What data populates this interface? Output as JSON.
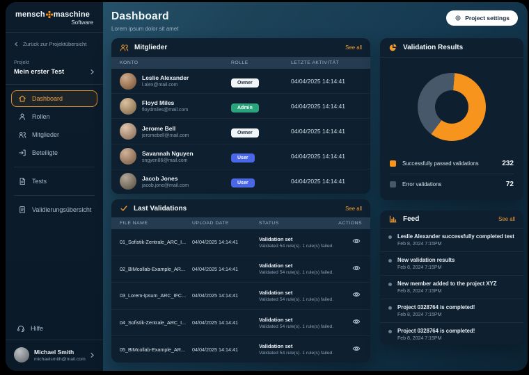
{
  "header": {
    "title": "Dashboard",
    "subtitle": "Lorem ipsum dolor sit amet",
    "settings_button": "Project settings"
  },
  "sidebar": {
    "logo": {
      "word1": "mensch",
      "word2": "maschine",
      "subtitle": "Software"
    },
    "back_link": "Zurück zur Projektübersicht",
    "project": {
      "label": "Projekt",
      "name": "Mein erster Test"
    },
    "nav": [
      {
        "label": "Dashboard"
      },
      {
        "label": "Rollen"
      },
      {
        "label": "Mitglieder"
      },
      {
        "label": "Beteiligte"
      },
      {
        "label": "Tests"
      },
      {
        "label": "Validierungsübersicht"
      }
    ],
    "help_label": "Hilfe",
    "user": {
      "name": "Michael Smith",
      "email": "michaelsmith@mail.com",
      "avatar_color": "#97a0a6"
    }
  },
  "members": {
    "title": "Mitglieder",
    "see_all": "See all",
    "columns": {
      "account": "KONTO",
      "role": "ROLLE",
      "activity": "LETZTE AKTIVITÄT"
    },
    "rows": [
      {
        "name": "Leslie Alexander",
        "email": "l.alex@mail.com",
        "role": "Owner",
        "role_bg": "#f2f5f8",
        "role_fg": "#1d2f41",
        "activity": "04/04/2025 14:14:41",
        "avatar_color": "#b97f4e"
      },
      {
        "name": "Floyd Miles",
        "email": "floydmiles@mail.com",
        "role": "Admin",
        "role_bg": "#2aa57b",
        "role_fg": "#ffffff",
        "activity": "04/04/2025 14:14:41",
        "avatar_color": "#c9a06b"
      },
      {
        "name": "Jerome Bell",
        "email": "jeromebell@mail.com",
        "role": "Owner",
        "role_bg": "#f2f5f8",
        "role_fg": "#1d2f41",
        "activity": "04/04/2025 14:14:41",
        "avatar_color": "#d3a882"
      },
      {
        "name": "Savannah Nguyen",
        "email": "sngyen86@mail.com",
        "role": "User",
        "role_bg": "#4a67e8",
        "role_fg": "#ffffff",
        "activity": "04/04/2025 14:14:41",
        "avatar_color": "#b98a63"
      },
      {
        "name": "Jacob Jones",
        "email": "jacob.jone@mail.com",
        "role": "User",
        "role_bg": "#4a67e8",
        "role_fg": "#ffffff",
        "activity": "04/04/2025 14:14:41",
        "avatar_color": "#8a7a62"
      }
    ]
  },
  "validations": {
    "title": "Last Validations",
    "see_all": "See all",
    "columns": {
      "file": "FILE NAME",
      "date": "UPLOAD DATE",
      "status": "STATUS",
      "actions": "ACTIONS"
    },
    "rows": [
      {
        "file": "01_Sofistik-Zentrale_ARC_I...",
        "date": "04/04/2025 14:14:41",
        "status_title": "Validation set",
        "status_sub": "Validated 54 rule(s). 1 rule(s) failed."
      },
      {
        "file": "02_BIMcollab-Example_AR...",
        "date": "04/04/2025 14:14:41",
        "status_title": "Validation set",
        "status_sub": "Validated 54 rule(s). 1 rule(s) failed."
      },
      {
        "file": "03_Lorem-Ipsum_ARC_IFC...",
        "date": "04/04/2025 14:14:41",
        "status_title": "Validation set",
        "status_sub": "Validated 54 rule(s). 1 rule(s) failed."
      },
      {
        "file": "04_Sofistik-Zentrale_ARC_I...",
        "date": "04/04/2025 14:14:41",
        "status_title": "Validation set",
        "status_sub": "Validated 54 rule(s). 1 rule(s) failed."
      },
      {
        "file": "05_BIMcollab-Example_AR...",
        "date": "04/04/2025 14:14:41",
        "status_title": "Validation set",
        "status_sub": "Validated 54 rule(s). 1 rule(s) failed."
      }
    ]
  },
  "chart_data": {
    "type": "pie",
    "donut": true,
    "title": "Validation Results",
    "labels": [
      "Successfully passed validations",
      "Error validations"
    ],
    "values": [
      232,
      72
    ],
    "colors": [
      "#f7941e",
      "#46586a"
    ],
    "legend_position": "bottom",
    "visual": {
      "start_deg": 5,
      "sweep_deg": [
        212,
        148
      ],
      "hole_color": "#0e1f2f"
    }
  },
  "feed": {
    "title": "Feed",
    "see_all": "See all",
    "items": [
      {
        "text": "Leslie Alexander successfully completed test",
        "time": "Feb 8, 2024 7:15PM"
      },
      {
        "text": "New validation results",
        "time": "Feb 8, 2024 7:15PM"
      },
      {
        "text": "New member added to the project XYZ",
        "time": "Feb 8, 2024 7:15PM"
      },
      {
        "text": "Project 0328764 is completed!",
        "time": "Feb 8, 2024 7:15PM"
      },
      {
        "text": "Project 0328764 is completed!",
        "time": "Feb 8, 2024 7:15PM"
      }
    ]
  },
  "colors": {
    "accent_orange": "#f09b2f",
    "sidebar_bg": "#0b1a28",
    "card_bg": "#0e1f2f",
    "table_head_bg": "#243b50"
  }
}
